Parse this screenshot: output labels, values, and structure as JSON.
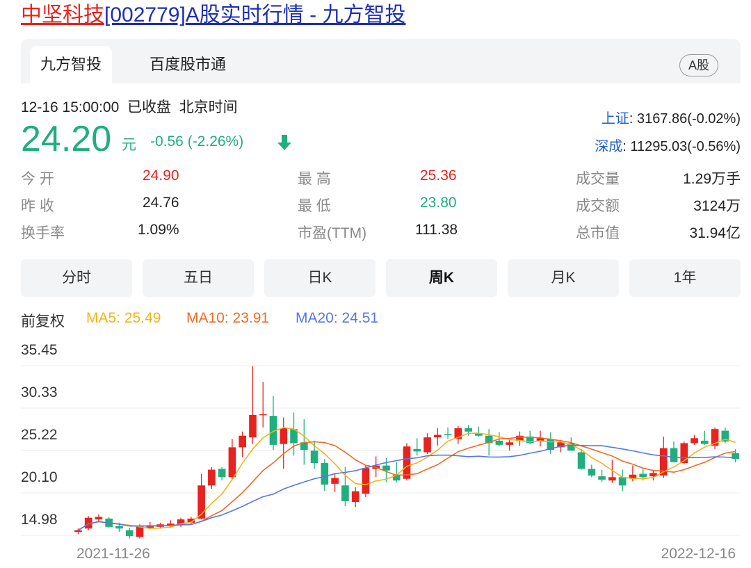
{
  "page_title": {
    "name": "中坚科技",
    "code": "[002779]",
    "rest": "A股实时行情 - 九方智投"
  },
  "tabs": {
    "active": "九方智投",
    "other": "百度股市通",
    "market_badge": "A股"
  },
  "quote": {
    "timestamp": "12-16 15:00:00",
    "status": "已收盘",
    "timezone": "北京时间",
    "price": "24.20",
    "unit": "元",
    "change": "-0.56 (-2.26%)"
  },
  "indices": [
    {
      "name": "上证",
      "value": ": 3167.86(-0.02%)"
    },
    {
      "name": "深成",
      "value": ": 11295.03(-0.56%)"
    }
  ],
  "stats": {
    "open_label": "今  开",
    "open_value": "24.90",
    "prev_close_label": "昨  收",
    "prev_close_value": "24.76",
    "turnover_label": "换手率",
    "turnover_value": "1.09%",
    "high_label": "最  高",
    "high_value": "25.36",
    "low_label": "最  低",
    "low_value": "23.80",
    "pe_label": "市盈(TTM)",
    "pe_value": "111.38",
    "volume_label": "成交量",
    "volume_value": "1.29万手",
    "amount_label": "成交额",
    "amount_value": "3124万",
    "mcap_label": "总市值",
    "mcap_value": "31.94亿"
  },
  "periods": [
    "分时",
    "五日",
    "日K",
    "周K",
    "月K",
    "1年"
  ],
  "selected_period": "周K",
  "ma_legend": {
    "adjust": "前复权",
    "ma5": "MA5: 25.49",
    "ma10": "MA10: 23.91",
    "ma20": "MA20: 24.51"
  },
  "colors": {
    "up": "#e8221e",
    "down": "#1fae7d",
    "ma5": "#f5b21b",
    "ma10": "#f06b25",
    "ma20": "#5577e8",
    "link_blue": "#1d2fb5"
  },
  "chart_data": {
    "type": "candlestick",
    "period": "weekly",
    "y_ticks": [
      "35.45",
      "30.33",
      "25.22",
      "20.10",
      "14.98"
    ],
    "ylim": [
      14.98,
      35.45
    ],
    "x_labels": [
      "2021-11-26",
      "2022-12-16"
    ],
    "grid": true,
    "candles": [
      [
        15.4,
        15.8,
        15.1,
        15.6
      ],
      [
        15.8,
        17.3,
        15.6,
        17.1
      ],
      [
        16.9,
        17.5,
        16.6,
        17.2
      ],
      [
        17.0,
        17.2,
        15.9,
        16.0
      ],
      [
        16.1,
        16.5,
        15.4,
        15.8
      ],
      [
        15.6,
        15.9,
        14.6,
        14.9
      ],
      [
        14.8,
        16.3,
        14.6,
        16.1
      ],
      [
        15.9,
        16.6,
        15.7,
        16.2
      ],
      [
        16.0,
        16.5,
        15.8,
        16.3
      ],
      [
        16.1,
        16.8,
        15.9,
        16.4
      ],
      [
        16.2,
        17.1,
        16.0,
        16.9
      ],
      [
        16.5,
        17.2,
        16.3,
        17.0
      ],
      [
        17.0,
        22.4,
        16.9,
        21.0
      ],
      [
        21.0,
        23.2,
        20.6,
        22.9
      ],
      [
        23.0,
        23.2,
        21.6,
        22.0
      ],
      [
        22.0,
        26.6,
        21.7,
        25.6
      ],
      [
        25.6,
        27.5,
        24.4,
        27.0
      ],
      [
        26.8,
        35.4,
        26.0,
        29.5
      ],
      [
        29.5,
        33.5,
        28.0,
        29.6
      ],
      [
        29.4,
        31.8,
        25.3,
        25.9
      ],
      [
        26.0,
        29.2,
        23.0,
        27.9
      ],
      [
        27.8,
        29.8,
        24.6,
        26.1
      ],
      [
        26.2,
        29.0,
        23.5,
        25.3
      ],
      [
        25.2,
        26.4,
        23.0,
        23.7
      ],
      [
        23.7,
        24.2,
        20.3,
        21.1
      ],
      [
        21.2,
        22.4,
        20.2,
        21.9
      ],
      [
        21.0,
        23.2,
        18.5,
        19.1
      ],
      [
        19.0,
        20.8,
        18.4,
        20.3
      ],
      [
        20.0,
        23.4,
        19.6,
        23.1
      ],
      [
        23.0,
        24.5,
        22.0,
        23.4
      ],
      [
        23.4,
        24.3,
        21.4,
        22.8
      ],
      [
        22.3,
        23.8,
        21.4,
        21.6
      ],
      [
        21.8,
        26.1,
        21.6,
        25.7
      ],
      [
        25.4,
        26.7,
        24.6,
        25.1
      ],
      [
        25.0,
        27.3,
        24.8,
        26.8
      ],
      [
        26.8,
        27.9,
        25.8,
        27.1
      ],
      [
        27.2,
        28.0,
        26.6,
        27.1
      ],
      [
        26.6,
        28.2,
        26.0,
        27.9
      ],
      [
        27.9,
        28.3,
        27.0,
        27.5
      ],
      [
        27.3,
        28.1,
        26.9,
        27.0
      ],
      [
        27.0,
        27.8,
        24.6,
        26.1
      ],
      [
        26.4,
        27.4,
        25.7,
        25.9
      ],
      [
        25.9,
        26.7,
        25.2,
        26.2
      ],
      [
        26.4,
        27.5,
        25.8,
        27.0
      ],
      [
        26.9,
        27.6,
        26.0,
        26.1
      ],
      [
        26.3,
        27.6,
        25.7,
        26.7
      ],
      [
        26.6,
        27.4,
        24.8,
        25.3
      ],
      [
        25.6,
        26.5,
        25.0,
        26.2
      ],
      [
        26.1,
        26.8,
        25.2,
        25.2
      ],
      [
        25.0,
        25.4,
        22.9,
        23.0
      ],
      [
        23.0,
        23.5,
        22.0,
        22.2
      ],
      [
        22.1,
        22.9,
        21.4,
        21.7
      ],
      [
        21.6,
        24.1,
        21.3,
        22.0
      ],
      [
        22.0,
        22.9,
        20.3,
        21.0
      ],
      [
        21.8,
        23.4,
        21.5,
        22.3
      ],
      [
        22.4,
        23.0,
        21.6,
        22.0
      ],
      [
        22.1,
        22.8,
        21.6,
        22.5
      ],
      [
        22.2,
        26.9,
        21.9,
        25.5
      ],
      [
        25.5,
        26.3,
        24.0,
        23.8
      ],
      [
        23.7,
        26.3,
        23.6,
        26.1
      ],
      [
        26.1,
        27.1,
        25.9,
        26.7
      ],
      [
        26.4,
        27.6,
        25.9,
        26.0
      ],
      [
        25.8,
        28.0,
        25.4,
        27.8
      ],
      [
        27.6,
        28.0,
        26.1,
        26.3
      ],
      [
        24.9,
        25.36,
        23.8,
        24.2
      ]
    ]
  }
}
